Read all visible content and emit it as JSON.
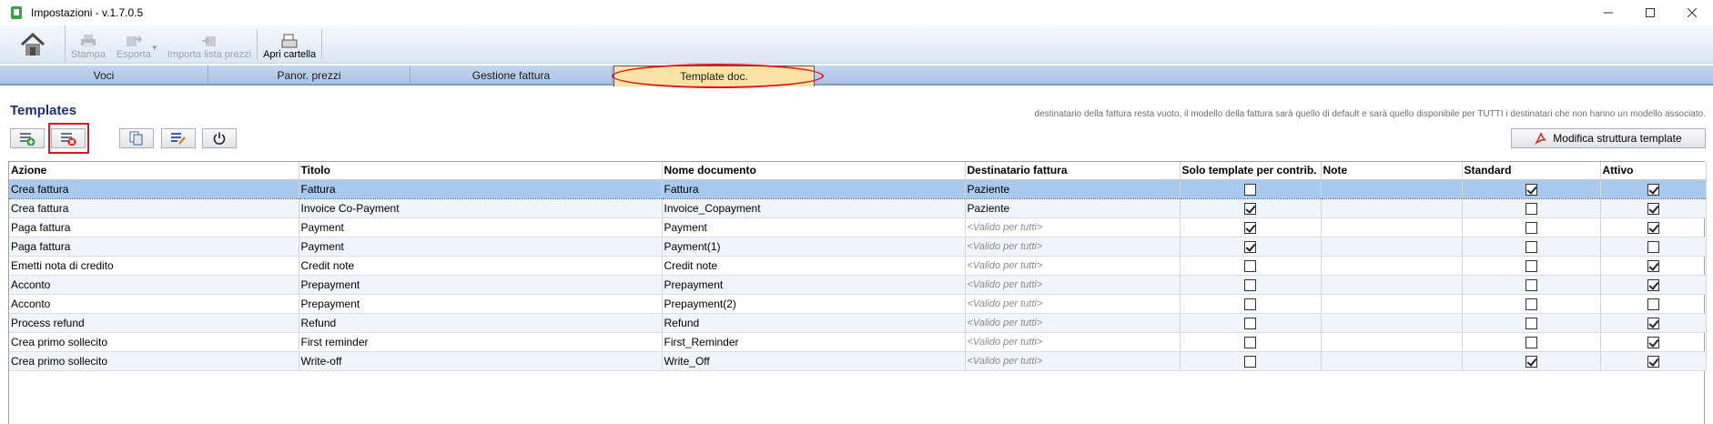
{
  "window": {
    "title": "Impostazioni  -  v.1.7.0.5"
  },
  "toolbar": {
    "buttons": [
      {
        "label": "Stampa",
        "enabled": false
      },
      {
        "label": "Esporta",
        "enabled": false
      },
      {
        "label": "Importa lista prezzi",
        "enabled": false
      },
      {
        "label": "Apri cartella",
        "enabled": true
      }
    ]
  },
  "tabs": [
    {
      "label": "Voci"
    },
    {
      "label": "Panor. prezzi"
    },
    {
      "label": "Gestione fattura"
    },
    {
      "label": "Template doc.",
      "active": true
    }
  ],
  "section": {
    "title": "Templates",
    "info": "destinatario della fattura resta vuoto, il modello della fattura sarà quello di default e sarà quello disponibile per TUTTI i destinatari che non hanno un modello associato."
  },
  "modify_button": {
    "label": "Modifica struttura template"
  },
  "table": {
    "headers": [
      "Azione",
      "Titolo",
      "Nome documento",
      "Destinatario fattura",
      "Solo template per contrib.",
      "Note",
      "Standard",
      "Attivo"
    ],
    "rows": [
      {
        "azione": "Crea fattura",
        "titolo": "Fattura",
        "nome": "Fattura",
        "dest": "Paziente",
        "dest_default": false,
        "solo": false,
        "note": "",
        "standard": true,
        "attivo": true,
        "selected": true
      },
      {
        "azione": "Crea fattura",
        "titolo": "Invoice Co-Payment",
        "nome": "Invoice_Copayment",
        "dest": "Paziente",
        "dest_default": false,
        "solo": true,
        "note": "",
        "standard": false,
        "attivo": true
      },
      {
        "azione": "Paga fattura",
        "titolo": "Payment",
        "nome": "Payment",
        "dest": "<Valido per tutti>",
        "dest_default": true,
        "solo": true,
        "note": "",
        "standard": false,
        "attivo": true
      },
      {
        "azione": "Paga fattura",
        "titolo": "Payment",
        "nome": "Payment(1)",
        "dest": "<Valido per tutti>",
        "dest_default": true,
        "solo": true,
        "note": "",
        "standard": false,
        "attivo": false
      },
      {
        "azione": "Emetti nota di credito",
        "titolo": "Credit note",
        "nome": "Credit note",
        "dest": "<Valido per tutti>",
        "dest_default": true,
        "solo": false,
        "note": "",
        "standard": false,
        "attivo": true
      },
      {
        "azione": "Acconto",
        "titolo": "Prepayment",
        "nome": "Prepayment",
        "dest": "<Valido per tutti>",
        "dest_default": true,
        "solo": false,
        "note": "",
        "standard": false,
        "attivo": true
      },
      {
        "azione": "Acconto",
        "titolo": "Prepayment",
        "nome": "Prepayment(2)",
        "dest": "<Valido per tutti>",
        "dest_default": true,
        "solo": false,
        "note": "",
        "standard": false,
        "attivo": false
      },
      {
        "azione": "Process refund",
        "titolo": "Refund",
        "nome": "Refund",
        "dest": "<Valido per tutti>",
        "dest_default": true,
        "solo": false,
        "note": "",
        "standard": false,
        "attivo": true
      },
      {
        "azione": "Crea primo sollecito",
        "titolo": "First reminder",
        "nome": "First_Reminder",
        "dest": "<Valido per tutti>",
        "dest_default": true,
        "solo": false,
        "note": "",
        "standard": false,
        "attivo": true
      },
      {
        "azione": "Crea primo sollecito",
        "titolo": "Write-off",
        "nome": "Write_Off",
        "dest": "<Valido per tutti>",
        "dest_default": true,
        "solo": false,
        "note": "",
        "standard": true,
        "attivo": true
      }
    ]
  },
  "colors": {
    "accent": "#1f2f78",
    "selection": "#a9c9ee",
    "active_tab": "#fbe3a6",
    "highlight": "#e0141e"
  },
  "icons": [
    "app-icon",
    "home-icon",
    "print-icon",
    "export-icon",
    "import-icon",
    "folder-icon",
    "add-row-icon",
    "delete-row-icon",
    "copy-icon",
    "edit-icon",
    "power-icon",
    "pdf-icon",
    "minimize-icon",
    "maximize-icon",
    "close-icon"
  ]
}
